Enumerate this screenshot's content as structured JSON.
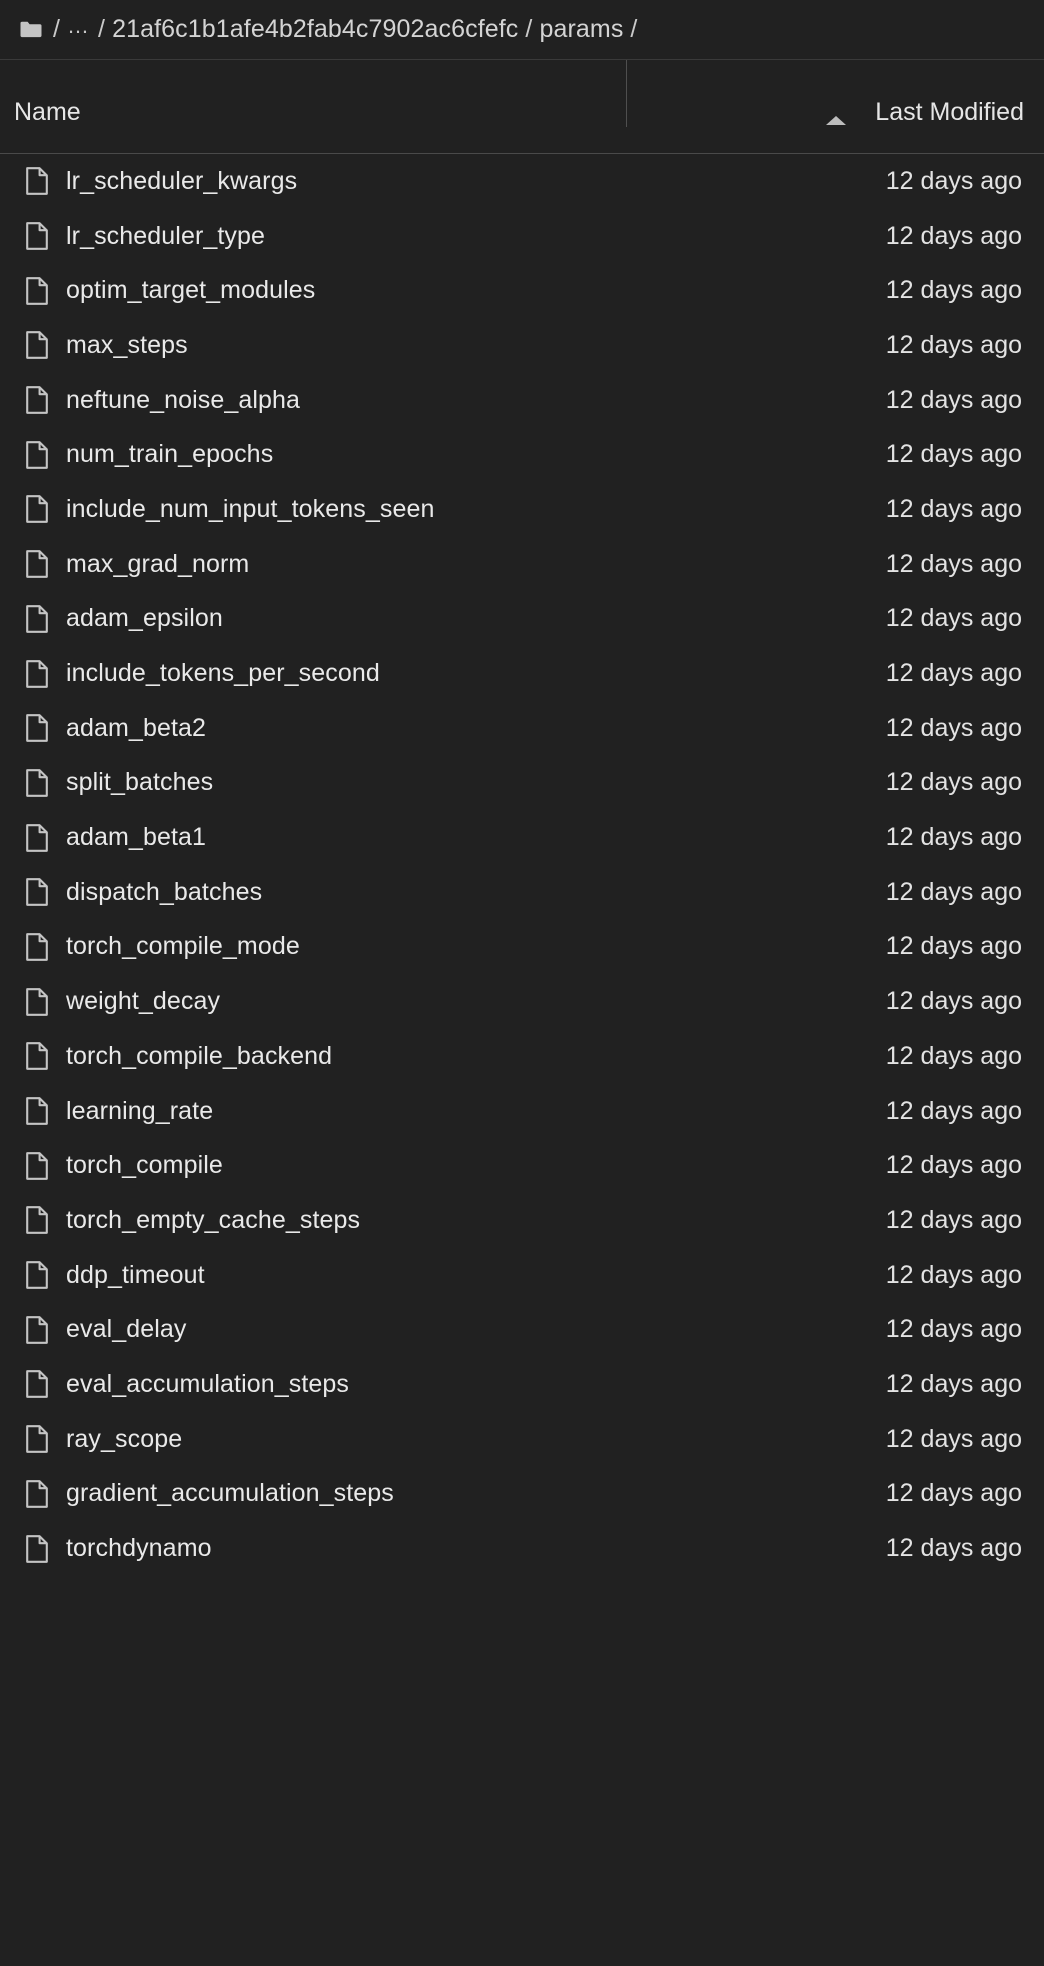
{
  "breadcrumb": {
    "root_icon": "folder-icon",
    "separator": "/",
    "ellipsis": "…",
    "segments": [
      "21af6c1b1afe4b2fab4c7902ac6cfefc",
      "params"
    ]
  },
  "table": {
    "columns": {
      "name": "Name",
      "last_modified": "Last Modified"
    },
    "sort": {
      "column": "Last Modified",
      "direction": "ascending",
      "icon": "caret-up-icon"
    },
    "rows": [
      {
        "icon": "file-icon",
        "name": "lr_scheduler_kwargs",
        "modified": "12 days ago"
      },
      {
        "icon": "file-icon",
        "name": "lr_scheduler_type",
        "modified": "12 days ago"
      },
      {
        "icon": "file-icon",
        "name": "optim_target_modules",
        "modified": "12 days ago"
      },
      {
        "icon": "file-icon",
        "name": "max_steps",
        "modified": "12 days ago"
      },
      {
        "icon": "file-icon",
        "name": "neftune_noise_alpha",
        "modified": "12 days ago"
      },
      {
        "icon": "file-icon",
        "name": "num_train_epochs",
        "modified": "12 days ago"
      },
      {
        "icon": "file-icon",
        "name": "include_num_input_tokens_seen",
        "modified": "12 days ago"
      },
      {
        "icon": "file-icon",
        "name": "max_grad_norm",
        "modified": "12 days ago"
      },
      {
        "icon": "file-icon",
        "name": "adam_epsilon",
        "modified": "12 days ago"
      },
      {
        "icon": "file-icon",
        "name": "include_tokens_per_second",
        "modified": "12 days ago"
      },
      {
        "icon": "file-icon",
        "name": "adam_beta2",
        "modified": "12 days ago"
      },
      {
        "icon": "file-icon",
        "name": "split_batches",
        "modified": "12 days ago"
      },
      {
        "icon": "file-icon",
        "name": "adam_beta1",
        "modified": "12 days ago"
      },
      {
        "icon": "file-icon",
        "name": "dispatch_batches",
        "modified": "12 days ago"
      },
      {
        "icon": "file-icon",
        "name": "torch_compile_mode",
        "modified": "12 days ago"
      },
      {
        "icon": "file-icon",
        "name": "weight_decay",
        "modified": "12 days ago"
      },
      {
        "icon": "file-icon",
        "name": "torch_compile_backend",
        "modified": "12 days ago"
      },
      {
        "icon": "file-icon",
        "name": "learning_rate",
        "modified": "12 days ago"
      },
      {
        "icon": "file-icon",
        "name": "torch_compile",
        "modified": "12 days ago"
      },
      {
        "icon": "file-icon",
        "name": "torch_empty_cache_steps",
        "modified": "12 days ago"
      },
      {
        "icon": "file-icon",
        "name": "ddp_timeout",
        "modified": "12 days ago"
      },
      {
        "icon": "file-icon",
        "name": "eval_delay",
        "modified": "12 days ago"
      },
      {
        "icon": "file-icon",
        "name": "eval_accumulation_steps",
        "modified": "12 days ago"
      },
      {
        "icon": "file-icon",
        "name": "ray_scope",
        "modified": "12 days ago"
      },
      {
        "icon": "file-icon",
        "name": "gradient_accumulation_steps",
        "modified": "12 days ago"
      },
      {
        "icon": "file-icon",
        "name": "torchdynamo",
        "modified": "12 days ago"
      }
    ]
  },
  "colors": {
    "background": "#212121",
    "text": "#e8e8e8",
    "muted_text": "#c9c9c9",
    "divider": "#4a4a4a",
    "icon": "#c4c4c4"
  }
}
